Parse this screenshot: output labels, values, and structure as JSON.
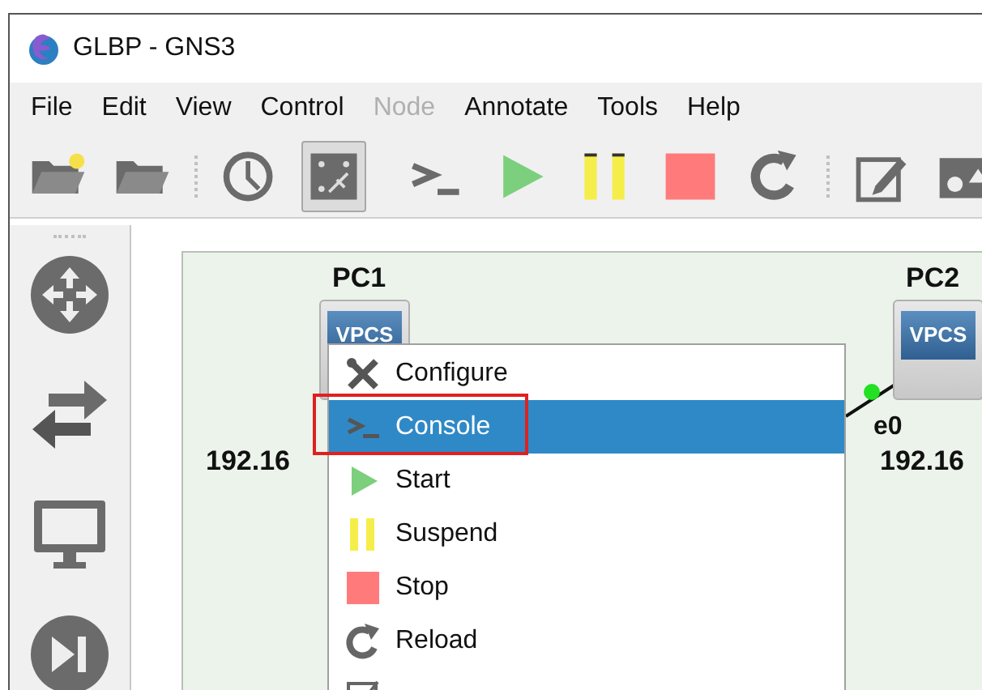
{
  "window": {
    "title": "GLBP - GNS3"
  },
  "menu_bar": [
    {
      "label": "File",
      "disabled": false
    },
    {
      "label": "Edit",
      "disabled": false
    },
    {
      "label": "View",
      "disabled": false
    },
    {
      "label": "Control",
      "disabled": false
    },
    {
      "label": "Node",
      "disabled": true
    },
    {
      "label": "Annotate",
      "disabled": false
    },
    {
      "label": "Tools",
      "disabled": false
    },
    {
      "label": "Help",
      "disabled": false
    }
  ],
  "toolbar": [
    {
      "kind": "new",
      "selected": false
    },
    {
      "kind": "open",
      "selected": false
    },
    {
      "kind": "grip"
    },
    {
      "kind": "clock",
      "selected": false
    },
    {
      "kind": "labels",
      "selected": true
    },
    {
      "kind": "separator"
    },
    {
      "kind": "console",
      "selected": false
    },
    {
      "kind": "start",
      "selected": false
    },
    {
      "kind": "suspend",
      "selected": false
    },
    {
      "kind": "stop",
      "selected": false
    },
    {
      "kind": "reload",
      "selected": false
    },
    {
      "kind": "grip"
    },
    {
      "kind": "note",
      "selected": false
    },
    {
      "kind": "image",
      "selected": false
    }
  ],
  "dock": [
    {
      "kind": "router"
    },
    {
      "kind": "switch"
    },
    {
      "kind": "monitor"
    },
    {
      "kind": "skip"
    }
  ],
  "nodes": [
    {
      "label": "PC1",
      "screen": "VPCS",
      "address": "192.16"
    },
    {
      "label": "PC2",
      "screen": "VPCS",
      "port": "e0",
      "address": "192.16"
    }
  ],
  "context_menu": [
    {
      "kind": "configure",
      "label": "Configure",
      "selected": false,
      "outlined": false
    },
    {
      "kind": "console",
      "label": "Console",
      "selected": true,
      "outlined": true
    },
    {
      "kind": "start",
      "label": "Start",
      "selected": false,
      "outlined": false
    },
    {
      "kind": "suspend",
      "label": "Suspend",
      "selected": false,
      "outlined": false
    },
    {
      "kind": "stop",
      "label": "Stop",
      "selected": false,
      "outlined": false
    },
    {
      "kind": "reload",
      "label": "Reload",
      "selected": false,
      "outlined": false
    },
    {
      "kind": "custom",
      "selected": false,
      "outlined": false
    }
  ]
}
